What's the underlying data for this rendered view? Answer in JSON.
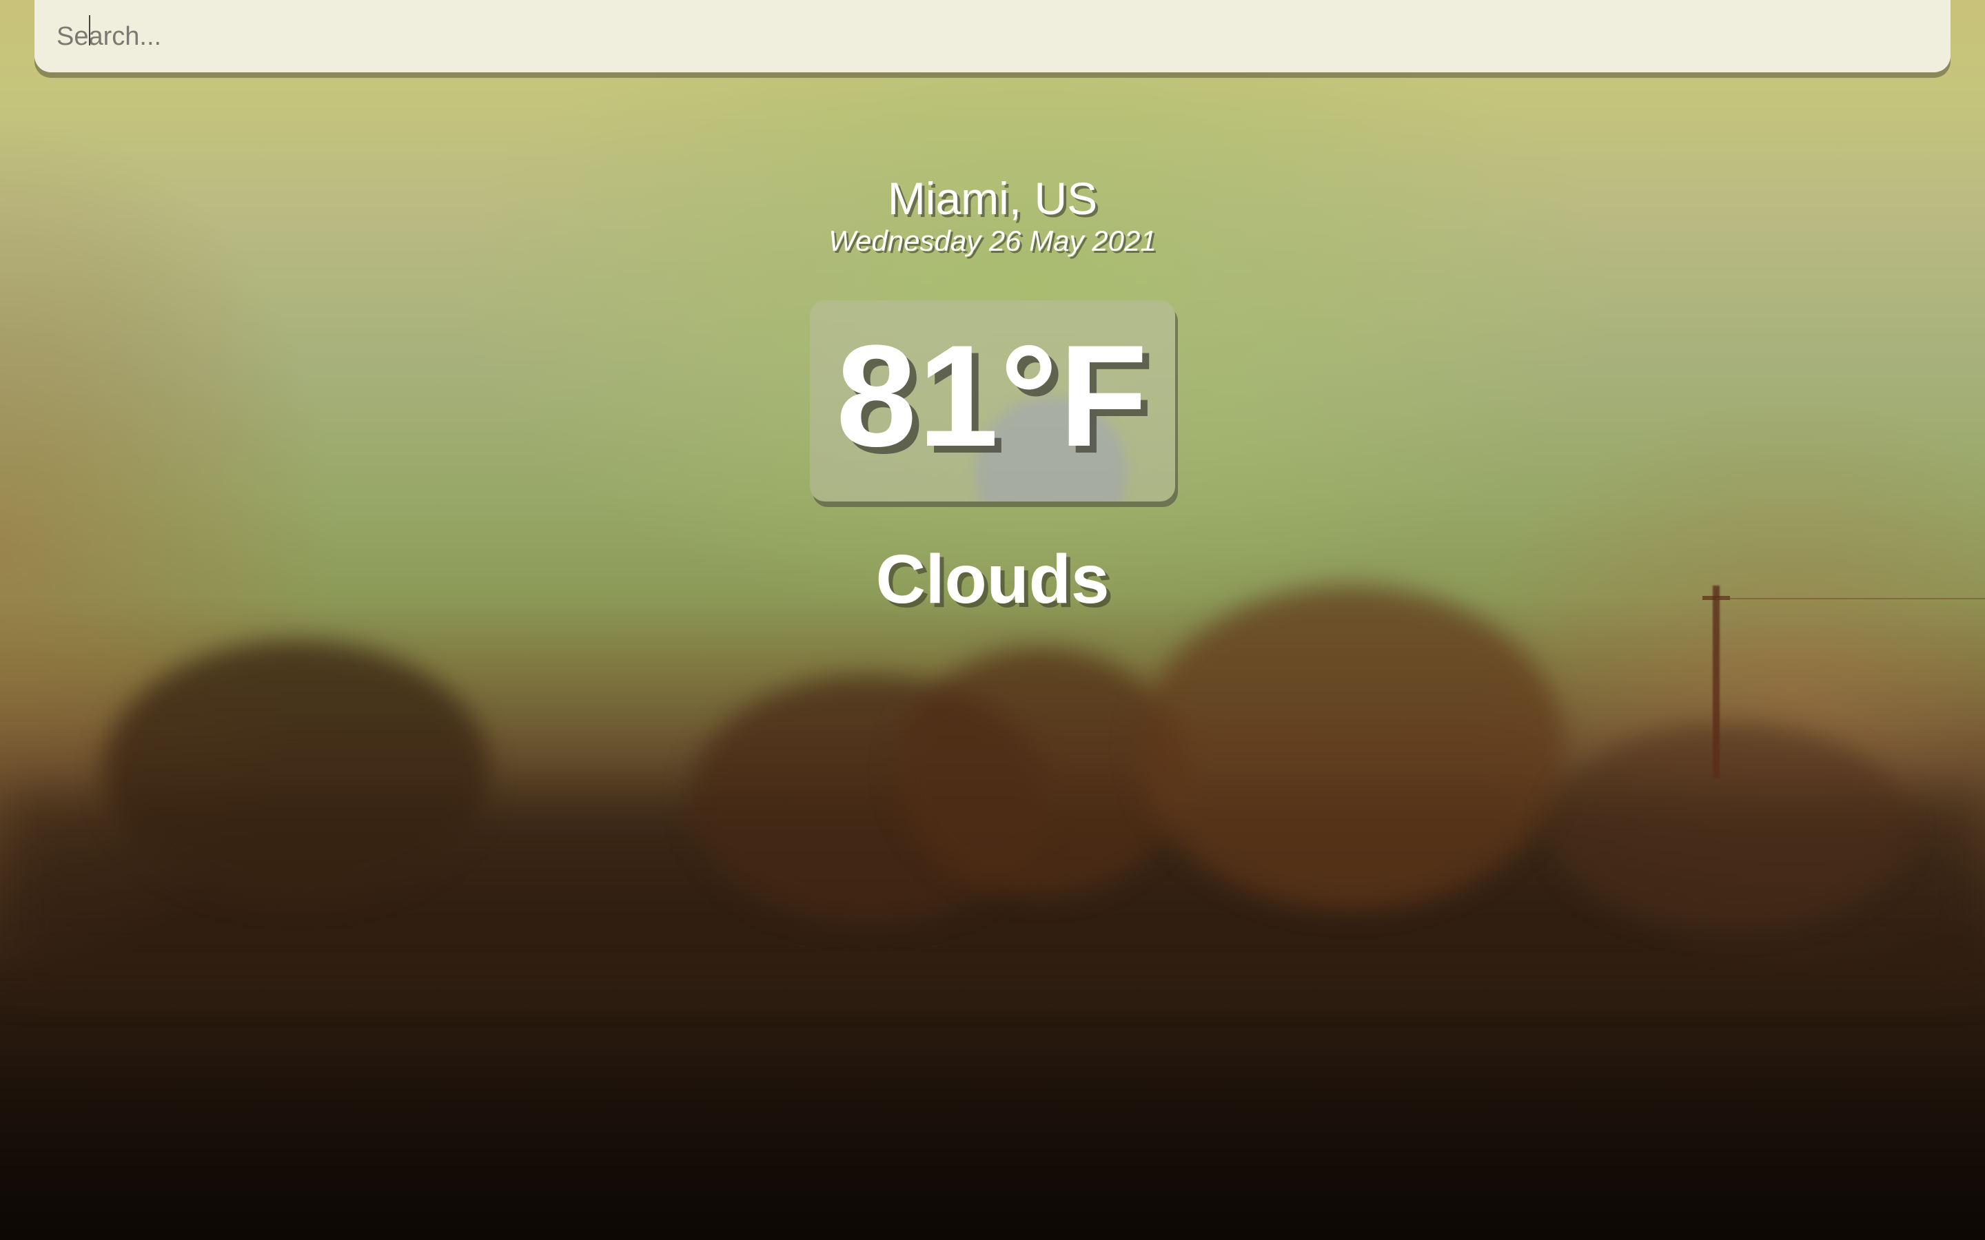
{
  "search": {
    "placeholder": "Search...",
    "value": ""
  },
  "weather": {
    "location": "Miami, US",
    "date": "Wednesday 26 May 2021",
    "temperature": "81°F",
    "condition": "Clouds"
  },
  "colors": {
    "search_bar_bg": "#f0efdd",
    "text": "#ffffff",
    "sky_top": "#c9c27a",
    "ground": "#0d0804"
  }
}
